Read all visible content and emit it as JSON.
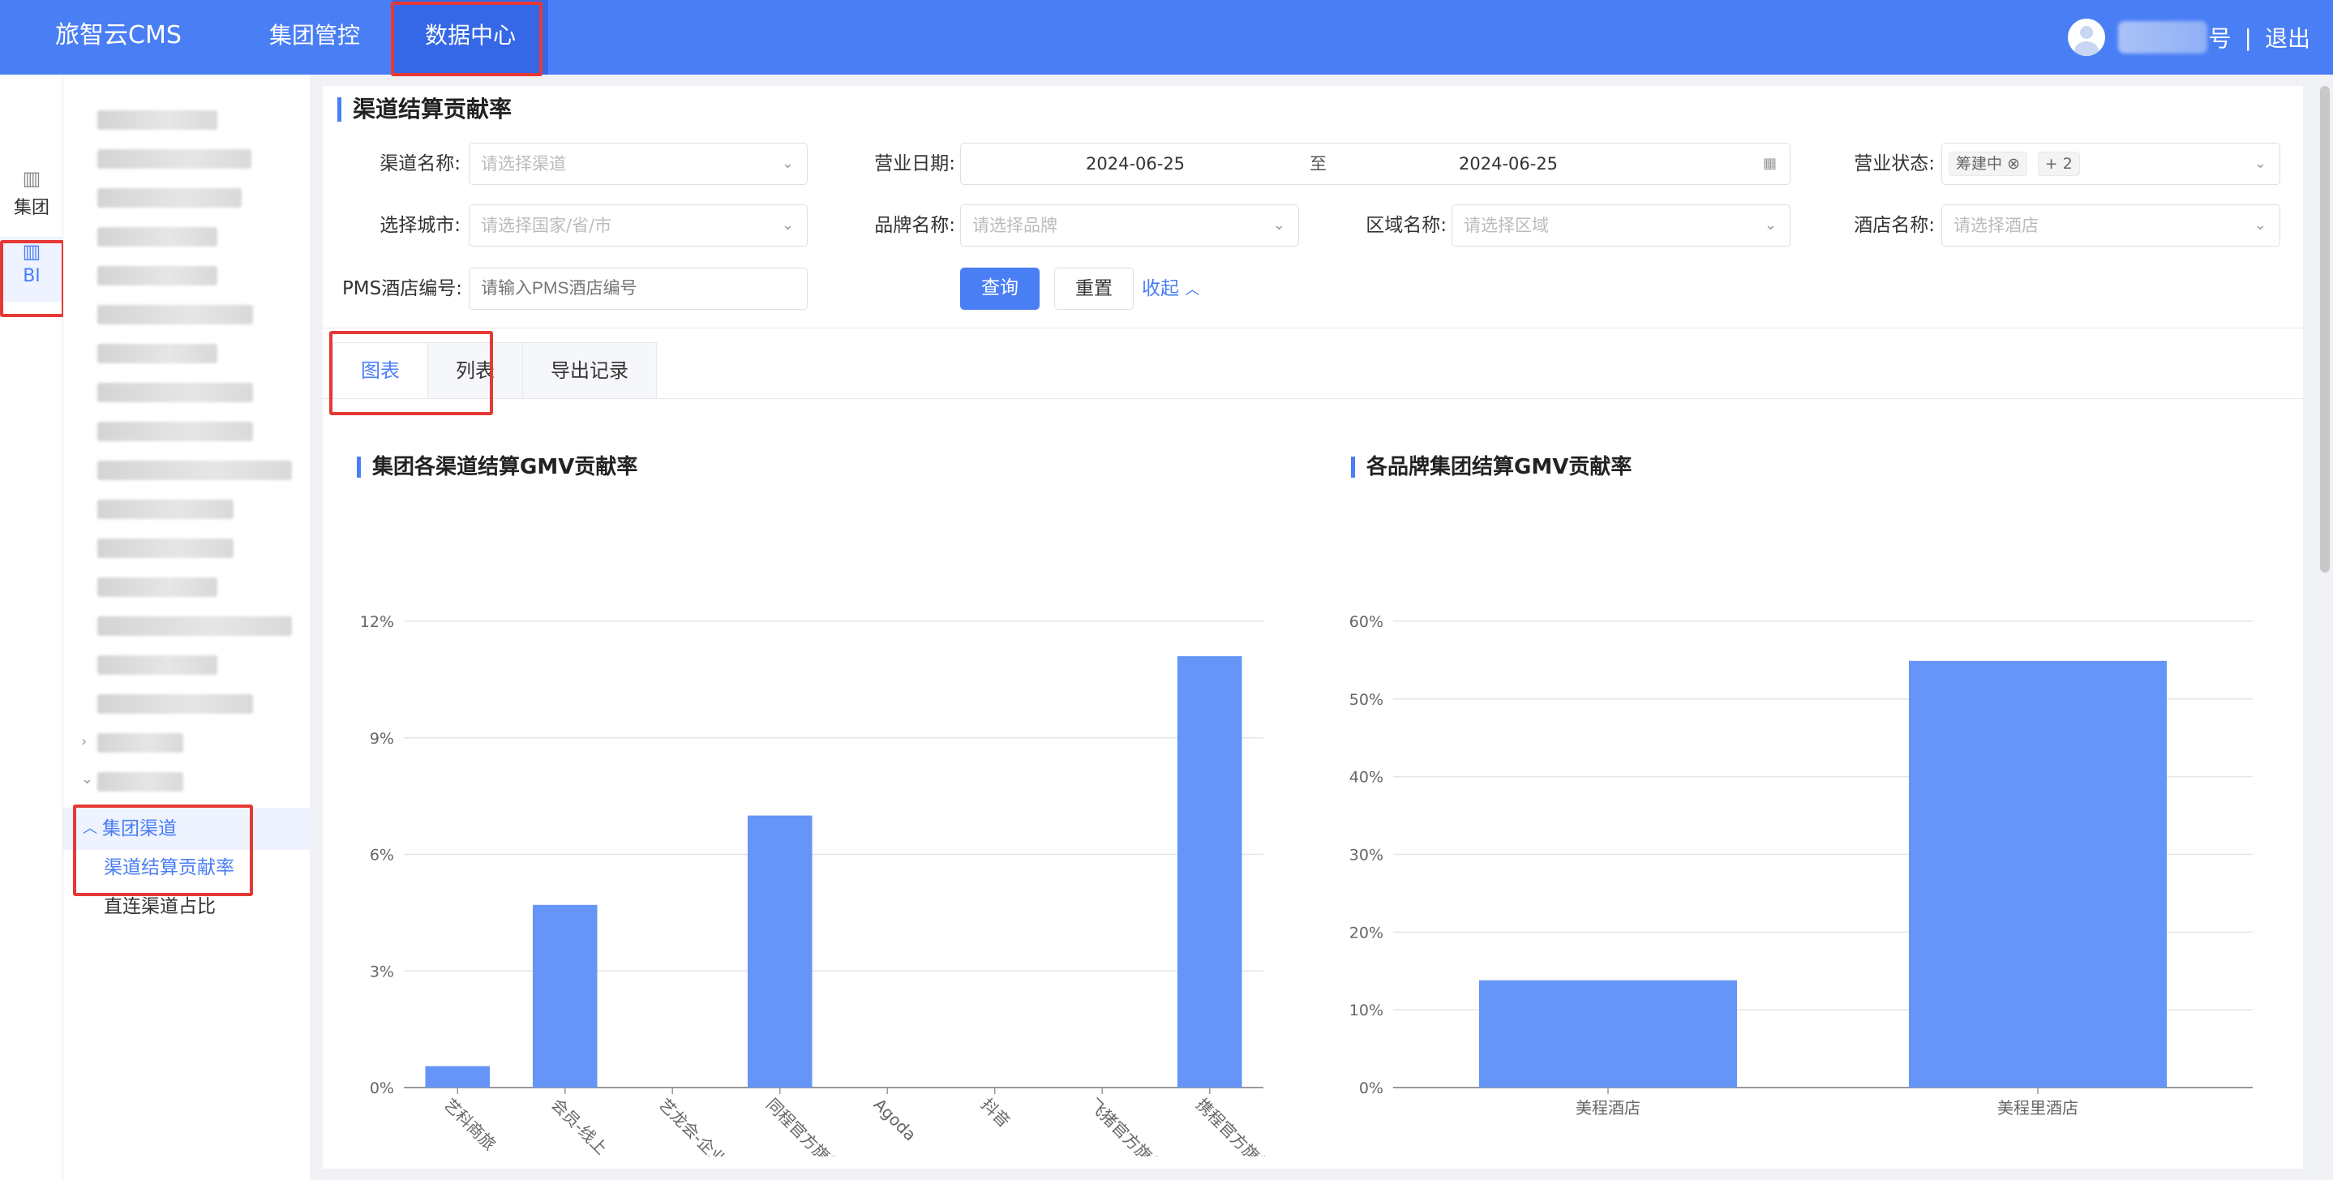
{
  "header": {
    "brand": "旅智云CMS",
    "nav": [
      {
        "label": "集团管控"
      },
      {
        "label": "数据中心"
      }
    ],
    "user_suffix": "号",
    "separator": "|",
    "logout": "退出"
  },
  "rail": [
    {
      "label": "集团",
      "icon": "building-icon"
    },
    {
      "label": "BI",
      "icon": "bar-chart-icon"
    }
  ],
  "menu": {
    "group_label": "集团渠道",
    "items": [
      {
        "label": "渠道结算贡献率"
      },
      {
        "label": "直连渠道占比"
      }
    ]
  },
  "page": {
    "title": "渠道结算贡献率"
  },
  "filters": {
    "channel": {
      "label": "渠道名称:",
      "placeholder": "请选择渠道"
    },
    "business_date": {
      "label": "营业日期:",
      "start": "2024-06-25",
      "to": "至",
      "end": "2024-06-25"
    },
    "business_status": {
      "label": "营业状态:",
      "tag": "筹建中",
      "more": "+ 2"
    },
    "city": {
      "label": "选择城市:",
      "placeholder": "请选择国家/省/市"
    },
    "brand": {
      "label": "品牌名称:",
      "placeholder": "请选择品牌"
    },
    "region": {
      "label": "区域名称:",
      "placeholder": "请选择区域"
    },
    "hotel": {
      "label": "酒店名称:",
      "placeholder": "请选择酒店"
    },
    "pms": {
      "label": "PMS酒店编号:",
      "placeholder": "请输入PMS酒店编号"
    },
    "query_button": "查询",
    "reset_button": "重置",
    "collapse_link": "收起"
  },
  "tabs": [
    {
      "label": "图表"
    },
    {
      "label": "列表"
    },
    {
      "label": "导出记录"
    }
  ],
  "chart_data": [
    {
      "type": "bar",
      "title": "集团各渠道结算GMV贡献率",
      "categories": [
        "艺科商旅",
        "会员-线上",
        "艺龙会-企业会员",
        "同程官方旗舰店",
        "Agoda",
        "抖音",
        "飞猪官方旗舰店",
        "携程官方旗舰店"
      ],
      "values": [
        0.55,
        4.7,
        0,
        7.0,
        0,
        0,
        0,
        11.1
      ],
      "yticks": [
        "0%",
        "3%",
        "6%",
        "9%",
        "12%"
      ],
      "ylim": [
        0,
        12
      ],
      "color": "#6495f7",
      "grid": true
    },
    {
      "type": "bar",
      "title": "各品牌集团结算GMV贡献率",
      "categories": [
        "美程酒店",
        "美程里酒店"
      ],
      "values": [
        13.8,
        54.9
      ],
      "yticks": [
        "0%",
        "10%",
        "20%",
        "30%",
        "40%",
        "50%",
        "60%"
      ],
      "ylim": [
        0,
        60
      ],
      "color": "#6495f7",
      "grid": true
    }
  ],
  "colors": {
    "accent": "#4a7ef5",
    "highlight": "#e53935"
  }
}
